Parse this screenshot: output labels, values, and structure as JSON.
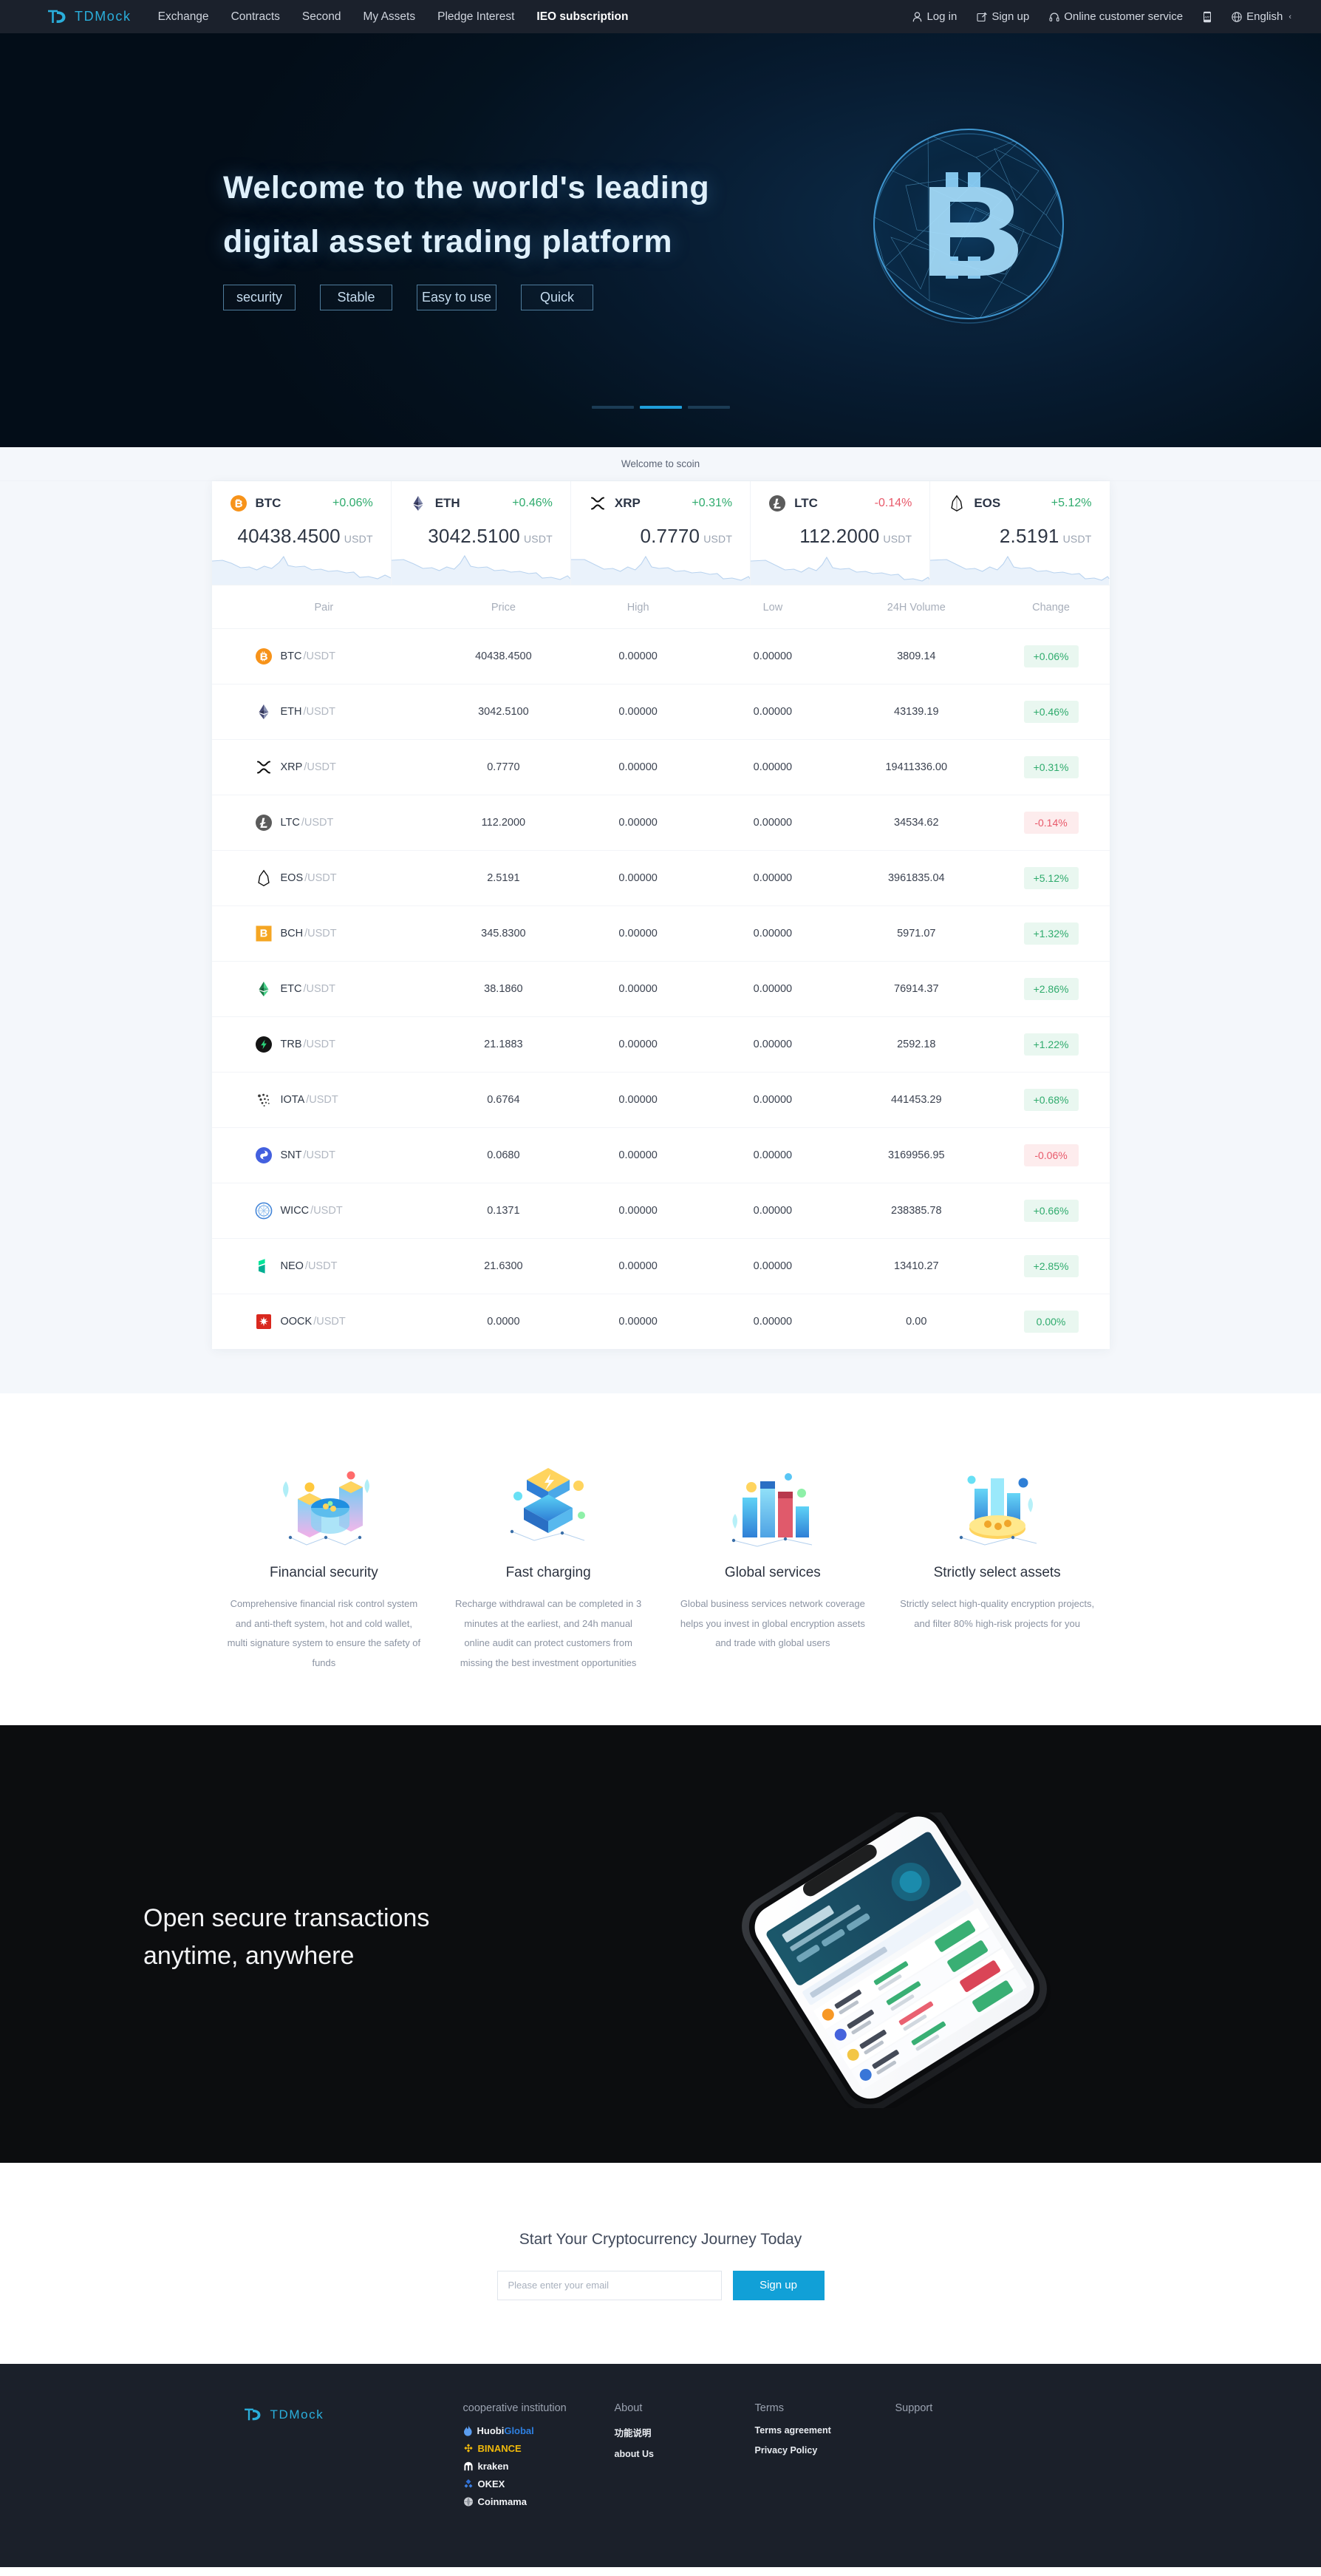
{
  "brand": {
    "name": "TDMock",
    "accent": "#2aaedb"
  },
  "topnav": {
    "links": [
      {
        "label": "Exchange",
        "active": false
      },
      {
        "label": "Contracts",
        "active": false
      },
      {
        "label": "Second",
        "active": false
      },
      {
        "label": "My Assets",
        "active": false
      },
      {
        "label": "Pledge Interest",
        "active": false
      },
      {
        "label": "IEO subscription",
        "active": true
      }
    ],
    "login": "Log in",
    "signup": "Sign up",
    "service": "Online customer service",
    "language": "English"
  },
  "hero": {
    "line1": "Welcome to the world's leading",
    "line2": "digital asset trading platform",
    "tags": [
      "security",
      "Stable",
      "Easy to use",
      "Quick"
    ],
    "caption": "Welcome to scoin",
    "dots": 3,
    "active_dot": 1
  },
  "tickers": [
    {
      "symbol": "BTC",
      "change": "+0.06%",
      "dir": "up",
      "price": "40438.4500",
      "unit": "USDT",
      "icon": "btc-icon"
    },
    {
      "symbol": "ETH",
      "change": "+0.46%",
      "dir": "up",
      "price": "3042.5100",
      "unit": "USDT",
      "icon": "eth-icon"
    },
    {
      "symbol": "XRP",
      "change": "+0.31%",
      "dir": "up",
      "price": "0.7770",
      "unit": "USDT",
      "icon": "xrp-icon"
    },
    {
      "symbol": "LTC",
      "change": "-0.14%",
      "dir": "down",
      "price": "112.2000",
      "unit": "USDT",
      "icon": "ltc-icon"
    },
    {
      "symbol": "EOS",
      "change": "+5.12%",
      "dir": "up",
      "price": "2.5191",
      "unit": "USDT",
      "icon": "eos-icon"
    }
  ],
  "market_table": {
    "headers": [
      "Pair",
      "Price",
      "High",
      "Low",
      "24H Volume",
      "Change"
    ],
    "rows": [
      {
        "base": "BTC",
        "quote": "/USDT",
        "price": "40438.4500",
        "price_dir": "up",
        "high": "0.00000",
        "low": "0.00000",
        "volume": "3809.14",
        "change": "+0.06%",
        "dir": "up",
        "icon": "btc-icon"
      },
      {
        "base": "ETH",
        "quote": "/USDT",
        "price": "3042.5100",
        "price_dir": "up",
        "high": "0.00000",
        "low": "0.00000",
        "volume": "43139.19",
        "change": "+0.46%",
        "dir": "up",
        "icon": "eth-icon"
      },
      {
        "base": "XRP",
        "quote": "/USDT",
        "price": "0.7770",
        "price_dir": "up",
        "high": "0.00000",
        "low": "0.00000",
        "volume": "19411336.00",
        "change": "+0.31%",
        "dir": "up",
        "icon": "xrp-icon"
      },
      {
        "base": "LTC",
        "quote": "/USDT",
        "price": "112.2000",
        "price_dir": "down",
        "high": "0.00000",
        "low": "0.00000",
        "volume": "34534.62",
        "change": "-0.14%",
        "dir": "down",
        "icon": "ltc-icon"
      },
      {
        "base": "EOS",
        "quote": "/USDT",
        "price": "2.5191",
        "price_dir": "up",
        "high": "0.00000",
        "low": "0.00000",
        "volume": "3961835.04",
        "change": "+5.12%",
        "dir": "up",
        "icon": "eos-icon"
      },
      {
        "base": "BCH",
        "quote": "/USDT",
        "price": "345.8300",
        "price_dir": "up",
        "high": "0.00000",
        "low": "0.00000",
        "volume": "5971.07",
        "change": "+1.32%",
        "dir": "up",
        "icon": "bch-icon"
      },
      {
        "base": "ETC",
        "quote": "/USDT",
        "price": "38.1860",
        "price_dir": "up",
        "high": "0.00000",
        "low": "0.00000",
        "volume": "76914.37",
        "change": "+2.86%",
        "dir": "up",
        "icon": "etc-icon"
      },
      {
        "base": "TRB",
        "quote": "/USDT",
        "price": "21.1883",
        "price_dir": "up",
        "high": "0.00000",
        "low": "0.00000",
        "volume": "2592.18",
        "change": "+1.22%",
        "dir": "up",
        "icon": "trb-icon"
      },
      {
        "base": "IOTA",
        "quote": "/USDT",
        "price": "0.6764",
        "price_dir": "up",
        "high": "0.00000",
        "low": "0.00000",
        "volume": "441453.29",
        "change": "+0.68%",
        "dir": "up",
        "icon": "iota-icon"
      },
      {
        "base": "SNT",
        "quote": "/USDT",
        "price": "0.0680",
        "price_dir": "down",
        "high": "0.00000",
        "low": "0.00000",
        "volume": "3169956.95",
        "change": "-0.06%",
        "dir": "down",
        "icon": "snt-icon"
      },
      {
        "base": "WICC",
        "quote": "/USDT",
        "price": "0.1371",
        "price_dir": "up",
        "high": "0.00000",
        "low": "0.00000",
        "volume": "238385.78",
        "change": "+0.66%",
        "dir": "up",
        "icon": "wicc-icon"
      },
      {
        "base": "NEO",
        "quote": "/USDT",
        "price": "21.6300",
        "price_dir": "up",
        "high": "0.00000",
        "low": "0.00000",
        "volume": "13410.27",
        "change": "+2.85%",
        "dir": "up",
        "icon": "neo-icon"
      },
      {
        "base": "OOCK",
        "quote": "/USDT",
        "price": "0.0000",
        "price_dir": "up",
        "high": "0.00000",
        "low": "0.00000",
        "volume": "0.00",
        "change": "0.00%",
        "dir": "up",
        "icon": "oock-icon"
      }
    ]
  },
  "features": [
    {
      "title": "Financial security",
      "desc": "Comprehensive financial risk control system and anti-theft system, hot and cold wallet, multi signature system to ensure the safety of funds"
    },
    {
      "title": "Fast charging",
      "desc": "Recharge withdrawal can be completed in 3 minutes at the earliest, and 24h manual online audit can protect customers from missing the best investment opportunities"
    },
    {
      "title": "Global services",
      "desc": "Global business services network coverage helps you invest in global encryption assets and trade with global users"
    },
    {
      "title": "Strictly select assets",
      "desc": "Strictly select high-quality encryption projects, and filter 80% high-risk projects for you"
    }
  ],
  "appband": {
    "line1": "Open secure transactions",
    "line2": "anytime, anywhere"
  },
  "cta": {
    "title": "Start Your Cryptocurrency Journey Today",
    "placeholder": "Please enter your email",
    "value": "",
    "button": "Sign up",
    "accent": "#11a0d7"
  },
  "footer": {
    "partners_title": "cooperative institution",
    "partners": [
      {
        "name": "Huobi",
        "name2": "Global",
        "icon": "huobi-icon"
      },
      {
        "name": "BINANCE",
        "name2": "",
        "icon": "binance-icon"
      },
      {
        "name": "kraken",
        "name2": "",
        "icon": "kraken-icon"
      },
      {
        "name": "OKEX",
        "name2": "",
        "icon": "okex-icon"
      },
      {
        "name": "Coinmama",
        "name2": "",
        "icon": "coinmama-icon"
      }
    ],
    "columns": [
      {
        "title": "About",
        "links": [
          "功能说明",
          "about Us"
        ]
      },
      {
        "title": "Terms",
        "links": [
          "Terms agreement",
          "Privacy Policy"
        ]
      },
      {
        "title": "Support",
        "links": []
      }
    ]
  }
}
